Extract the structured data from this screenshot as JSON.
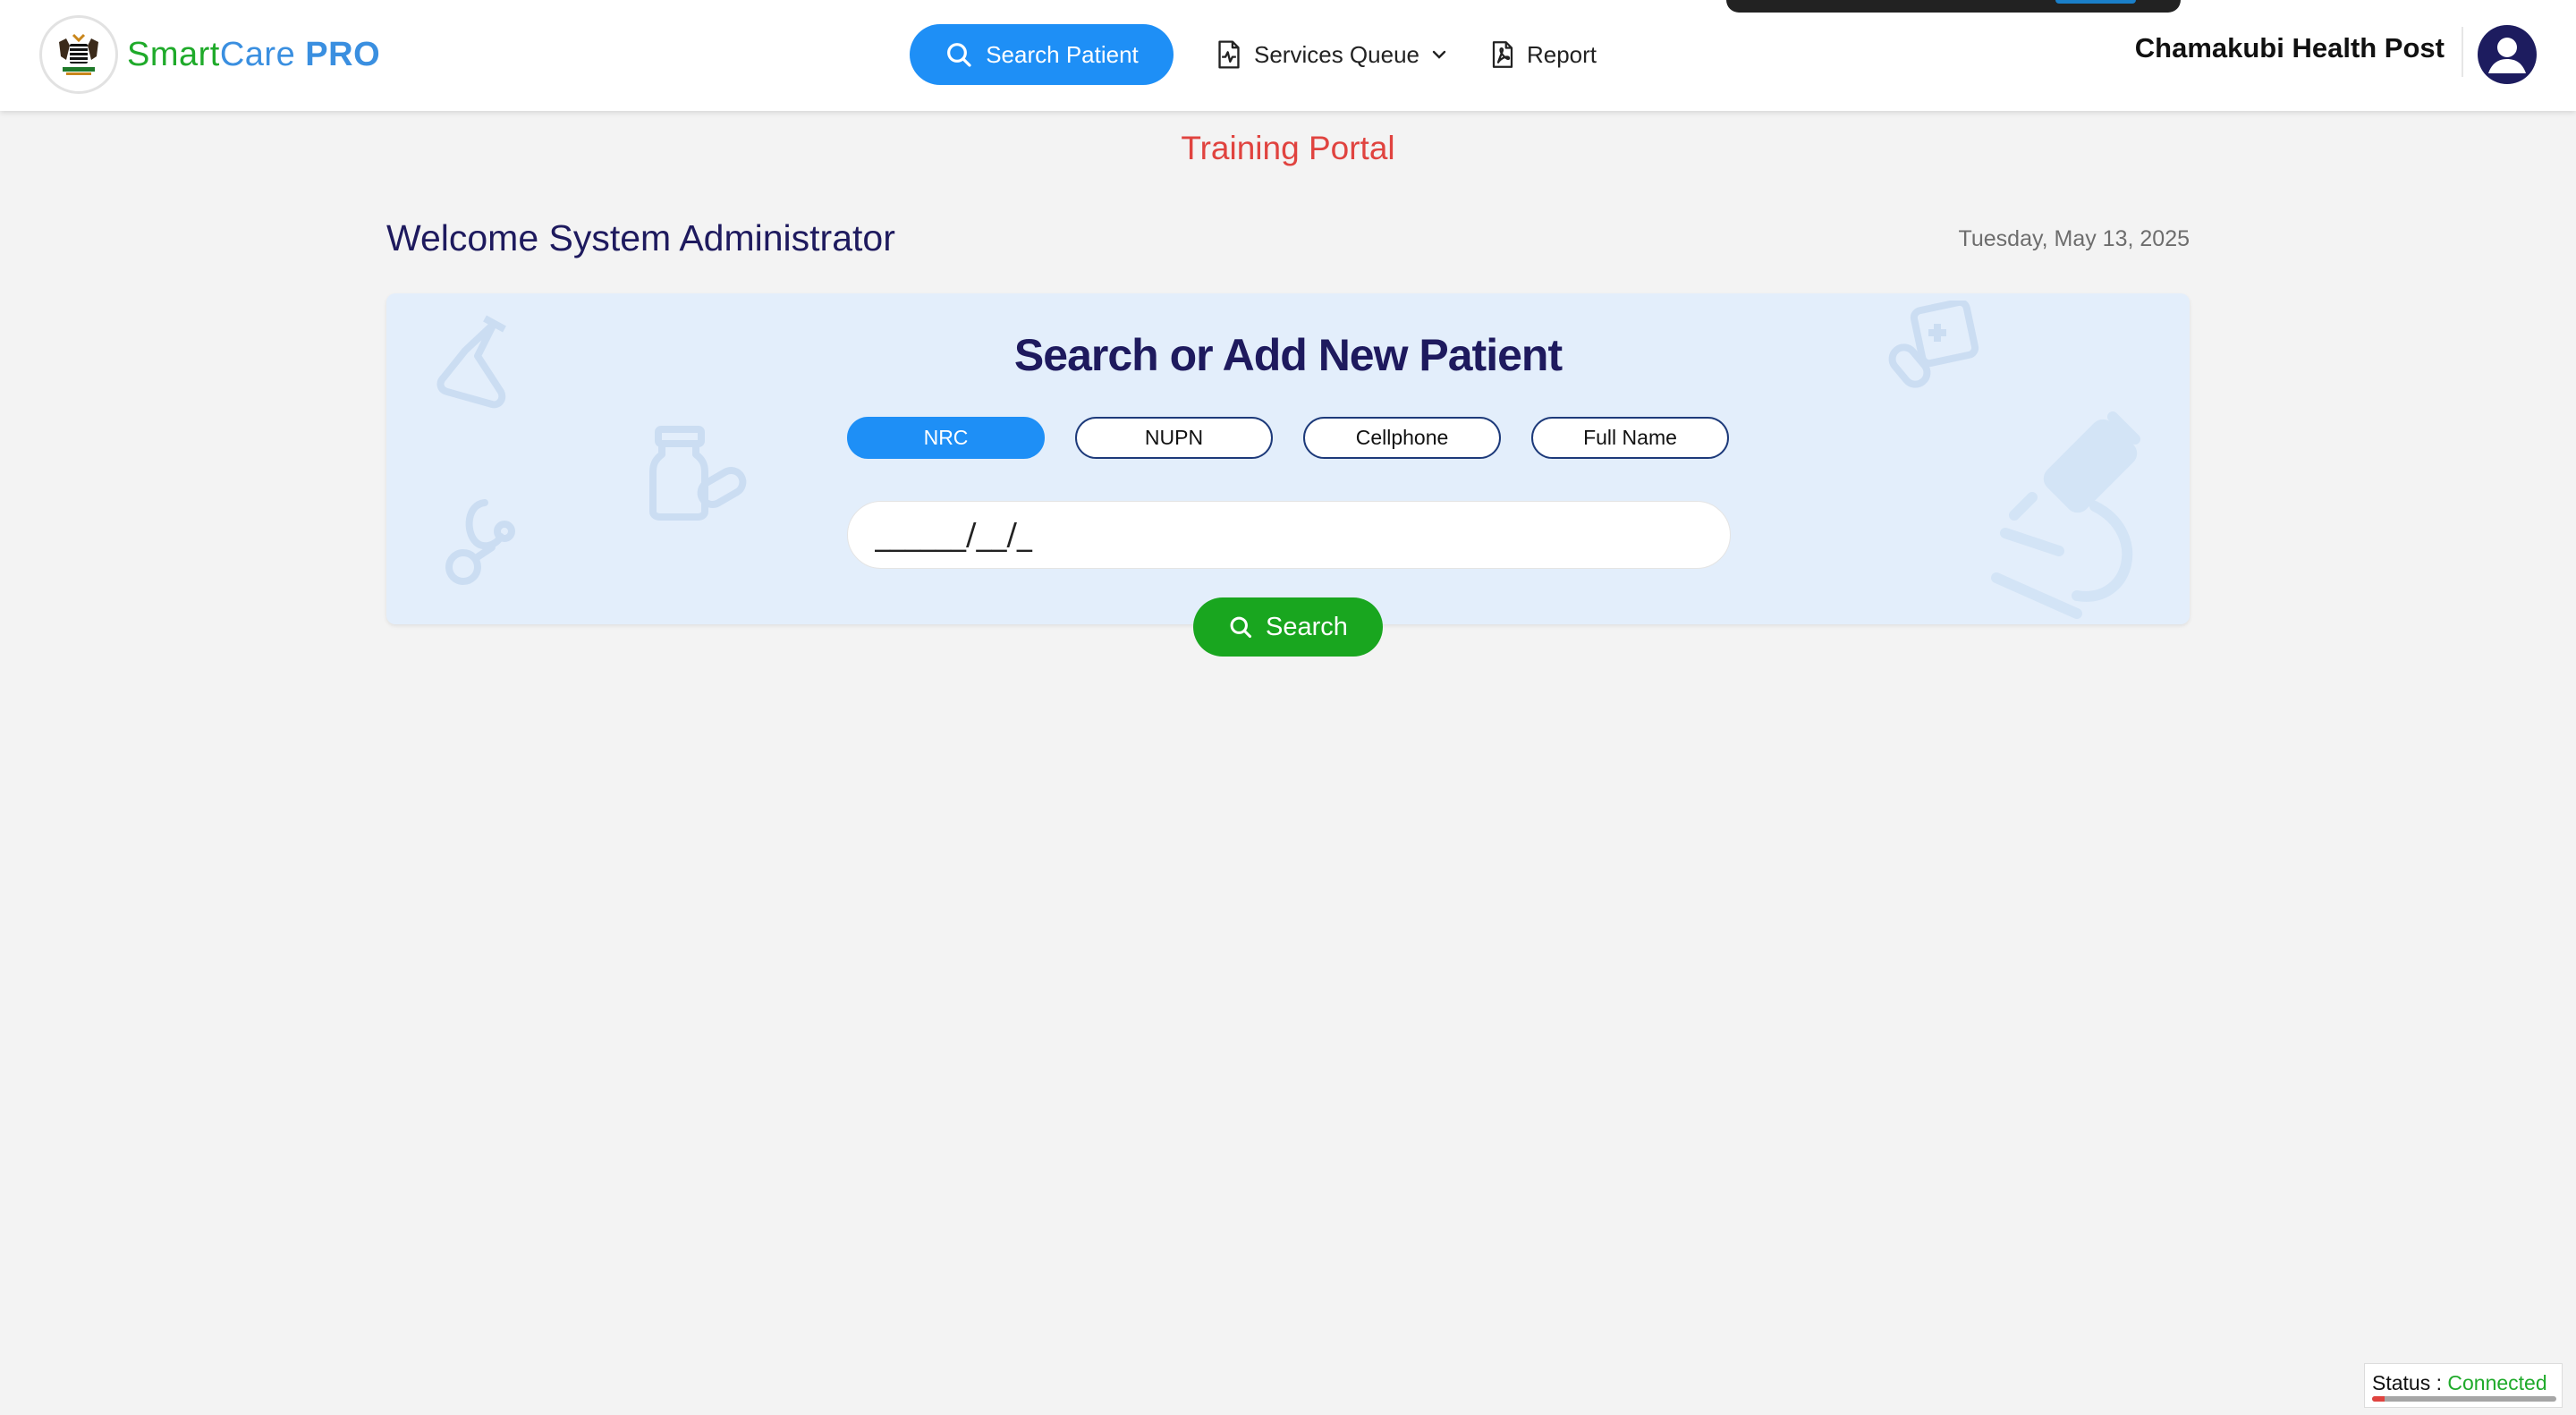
{
  "header": {
    "brand": {
      "smart": "Smart",
      "care": "Care",
      "pro": "PRO"
    },
    "nav": {
      "search_patient": "Search Patient",
      "services_queue": "Services Queue",
      "report": "Report"
    },
    "facility": "Chamakubi Health Post"
  },
  "portal_label": "Training Portal",
  "welcome": "Welcome System Administrator",
  "date": "Tuesday, May 13, 2025",
  "search_card": {
    "title": "Search or Add New Patient",
    "filters": [
      {
        "label": "NRC",
        "active": true
      },
      {
        "label": "NUPN",
        "active": false
      },
      {
        "label": "Cellphone",
        "active": false
      },
      {
        "label": "Full Name",
        "active": false
      }
    ],
    "input_value": "______/__/_",
    "search_button": "Search"
  },
  "status": {
    "label": "Status :",
    "value": "Connected"
  },
  "colors": {
    "accent_blue": "#1e8ff6",
    "brand_green": "#1faa2a",
    "navy": "#1e1a5e",
    "portal_red": "#e0433f",
    "search_green": "#19a61f"
  }
}
